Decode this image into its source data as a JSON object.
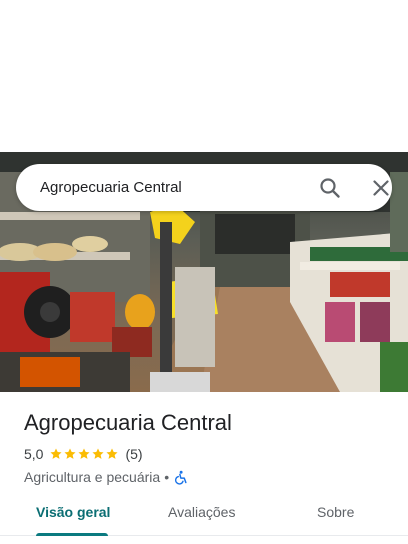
{
  "search": {
    "query": "Agropecuaria Central"
  },
  "hero": {
    "photo_icon": "store-interior-photo"
  },
  "place": {
    "title": "Agropecuaria Central",
    "rating": "5,0",
    "stars": 5,
    "review_count": "(5)",
    "category": "Agricultura e pecuária",
    "separator": "•",
    "accessibility_icon": "wheelchair-accessible-icon"
  },
  "tabs": [
    {
      "label": "Visão geral",
      "active": true
    },
    {
      "label": "Avaliações",
      "active": false
    },
    {
      "label": "Sobre",
      "active": false
    }
  ],
  "colors": {
    "accent": "#0b7a80",
    "star": "#fbbc04",
    "access": "#1a73e8"
  }
}
